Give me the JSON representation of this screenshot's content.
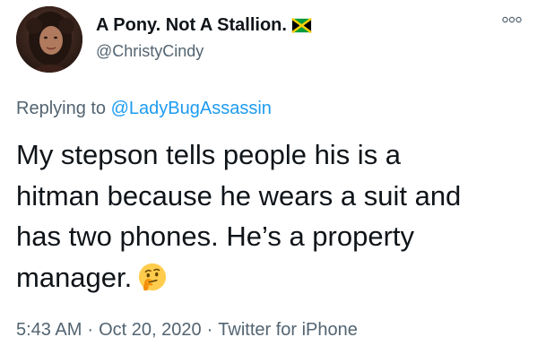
{
  "tweet": {
    "author": {
      "display_name": "A Pony. Not A Stallion.",
      "flag_icon": "jamaica-flag-emoji",
      "handle": "@ChristyCindy"
    },
    "more_icon": "ellipsis-icon",
    "reply": {
      "prefix": "Replying to",
      "mention": "@LadyBugAssassin"
    },
    "text_lines": [
      "My stepson tells people his is a",
      "hitman because he wears a suit and",
      "has two phones. He’s a property",
      "manager."
    ],
    "emoji_icon": "thinking-face-emoji",
    "meta": {
      "time": "5:43 AM",
      "separator": "·",
      "date": "Oct 20, 2020",
      "source": "Twitter for iPhone"
    }
  },
  "colors": {
    "text": "#0f1419",
    "secondary": "#536471",
    "link": "#1d9bf0",
    "background": "#ffffff"
  }
}
